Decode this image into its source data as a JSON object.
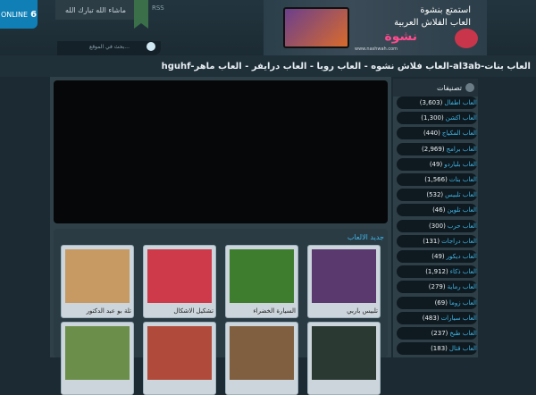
{
  "header": {
    "counter_label": "ONLINE",
    "counter_value": "6",
    "greeting_tab": "ماشاء الله تبارك الله",
    "rss": "RSS",
    "search_text": "بحث في الموقع...",
    "banner_line1": "استمتع بنشوة",
    "banner_line2": "العاب الفلاش العربية",
    "banner_logo": "نشوة",
    "banner_url": "www.nashwah.com"
  },
  "page_title": "hguhf-العاب فلاش نشوه - العاب روبا - العاب درايفر - العاب ماهر-al3ab-العاب بنات",
  "games_section": {
    "header": "جديد الالعاب",
    "cards": [
      {
        "caption": "تلبيس باربي",
        "color": "#5a3a6e"
      },
      {
        "caption": "السيارة الخضراء",
        "color": "#3e7d2e"
      },
      {
        "caption": "تشكيل الاشكال",
        "color": "#cf3a4a"
      },
      {
        "caption": "تلة بو عبد الدكتور",
        "color": "#c79a63"
      },
      {
        "caption": "",
        "color": "#2a3a32"
      },
      {
        "caption": "",
        "color": "#7f5f3f"
      },
      {
        "caption": "",
        "color": "#b04a3a"
      },
      {
        "caption": "",
        "color": "#6b8f4a"
      }
    ]
  },
  "sidebar": {
    "title": "تصنيفات",
    "items": [
      {
        "label": "العاب اطفال",
        "count": "(3,603)"
      },
      {
        "label": "العاب اكشن",
        "count": "(1,300)"
      },
      {
        "label": "العاب المكياج",
        "count": "(440)"
      },
      {
        "label": "العاب برامج",
        "count": "(2,969)"
      },
      {
        "label": "العاب بلياردو",
        "count": "(49)"
      },
      {
        "label": "العاب بنات",
        "count": "(1,566)"
      },
      {
        "label": "العاب تلبيس",
        "count": "(532)"
      },
      {
        "label": "العاب تلوين",
        "count": "(46)"
      },
      {
        "label": "العاب حرب",
        "count": "(300)"
      },
      {
        "label": "العاب دراجات",
        "count": "(131)"
      },
      {
        "label": "العاب ديكور",
        "count": "(49)"
      },
      {
        "label": "العاب ذكاء",
        "count": "(1,912)"
      },
      {
        "label": "العاب رماية",
        "count": "(279)"
      },
      {
        "label": "العاب زوما",
        "count": "(69)"
      },
      {
        "label": "العاب سيارات",
        "count": "(483)"
      },
      {
        "label": "العاب طبخ",
        "count": "(237)"
      },
      {
        "label": "العاب قتال",
        "count": "(183)"
      }
    ]
  }
}
